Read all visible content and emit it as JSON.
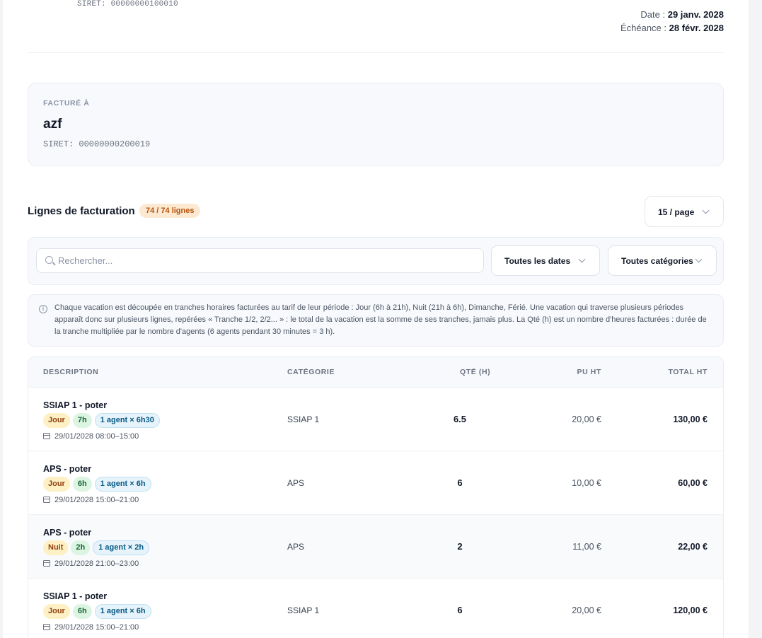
{
  "seller": {
    "siret": "SIRET: 00000000100010"
  },
  "invoice_meta": {
    "date_label": "Date :",
    "date_value": "29 janv. 2028",
    "due_label": "Échéance :",
    "due_value": "28 févr. 2028"
  },
  "bill_to": {
    "label": "FACTURÉ À",
    "name": "azf",
    "siret": "SIRET: 00000000200019"
  },
  "lines_section": {
    "title": "Lignes de facturation",
    "count_badge": "74 / 74 lignes",
    "per_page": "15 / page"
  },
  "filters": {
    "search_placeholder": "Rechercher...",
    "dates_select": "Toutes les dates",
    "categories_select": "Toutes catégories"
  },
  "info_note": "Chaque vacation est découpée en tranches horaires facturées au tarif de leur période : Jour (6h à 21h), Nuit (21h à 6h), Dimanche, Férié. Une vacation qui traverse plusieurs périodes apparaît donc sur plusieurs lignes, repérées « Tranche 1/2, 2/2... » : le total de la vacation est la somme de ses tranches, jamais plus. La Qté (h) est un nombre d'heures facturées : durée de la tranche multipliée par le nombre d'agents (6 agents pendant 30 minutes = 3 h).",
  "table": {
    "headers": {
      "description": "DESCRIPTION",
      "category": "CATÉGORIE",
      "qty": "QTÉ (H)",
      "unit_price": "PU HT",
      "total": "TOTAL HT"
    },
    "rows": [
      {
        "description": "SSIAP 1 - poter",
        "period": "Jour",
        "hours": "7h",
        "agents": "1 agent × 6h30",
        "datetime": "29/01/2028 08:00–15:00",
        "category": "SSIAP 1",
        "qty": "6.5",
        "unit_price": "20,00 €",
        "total": "130,00 €"
      },
      {
        "description": "APS - poter",
        "period": "Jour",
        "hours": "6h",
        "agents": "1 agent × 6h",
        "datetime": "29/01/2028 15:00–21:00",
        "category": "APS",
        "qty": "6",
        "unit_price": "10,00 €",
        "total": "60,00 €"
      },
      {
        "description": "APS - poter",
        "period": "Nuit",
        "hours": "2h",
        "agents": "1 agent × 2h",
        "datetime": "29/01/2028 21:00–23:00",
        "category": "APS",
        "qty": "2",
        "unit_price": "11,00 €",
        "total": "22,00 €"
      },
      {
        "description": "SSIAP 1 - poter",
        "period": "Jour",
        "hours": "6h",
        "agents": "1 agent × 6h",
        "datetime": "29/01/2028 15:00–21:00",
        "category": "SSIAP 1",
        "qty": "6",
        "unit_price": "20,00 €",
        "total": "120,00 €"
      }
    ]
  }
}
